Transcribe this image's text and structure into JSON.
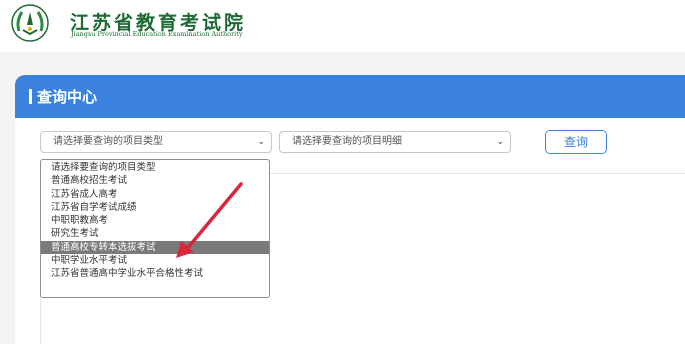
{
  "header": {
    "logo_cn": "江苏省教育考试院",
    "logo_en": "Jiangsu Provincial Education Examination Authority"
  },
  "panel": {
    "title": "查询中心"
  },
  "filters": {
    "type_select_value": "请选择要查询的项目类型",
    "detail_select_value": "请选择要查询的项目明细",
    "query_button": "查询"
  },
  "dropdown": {
    "selected_index": 6,
    "options": [
      "请选择要查询的项目类型",
      "普通高校招生考试",
      "江苏省成人高考",
      "江苏省自学考试成绩",
      "中职职教高考",
      "研究生考试",
      "普通高校专转本选拔考试",
      "中职学业水平考试",
      "江苏省普通高中学业水平合格性考试"
    ]
  },
  "colors": {
    "brand_green": "#1d6a34",
    "accent_blue": "#3b82df",
    "annotation_red": "#d9263d"
  },
  "icons": {
    "select_chevron": "chevron-down-icon",
    "annotation": "arrow-annotation"
  }
}
